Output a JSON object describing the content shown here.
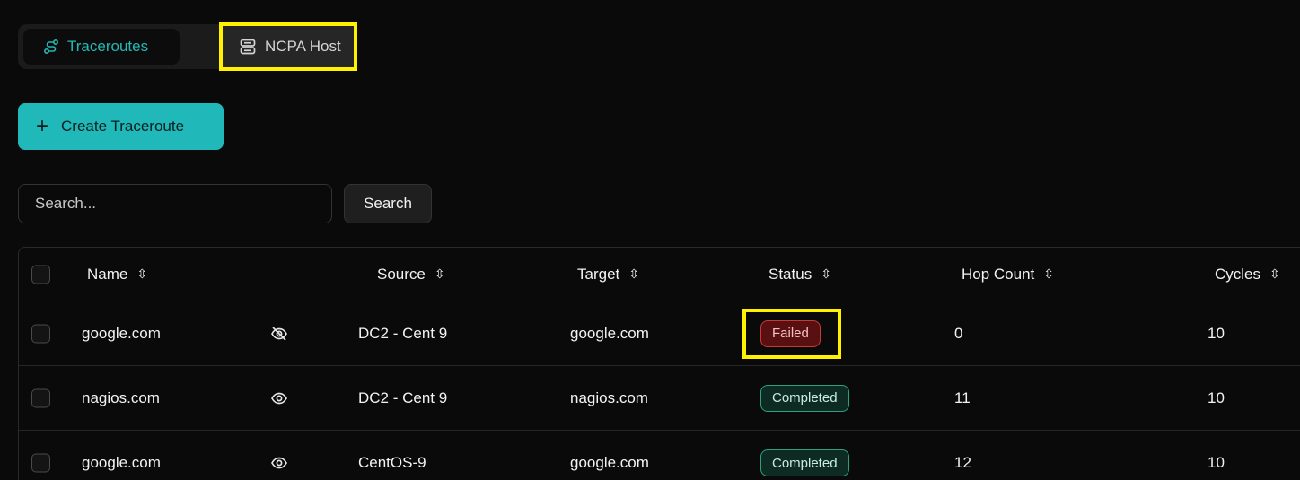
{
  "tabs": [
    {
      "label": "Traceroutes",
      "icon": "route-icon",
      "active": true
    },
    {
      "label": "NCPA Host",
      "icon": "server-icon",
      "active": false
    }
  ],
  "create_button": {
    "label": "Create Traceroute",
    "icon": "plus"
  },
  "search": {
    "placeholder": "Search...",
    "button_label": "Search"
  },
  "table": {
    "columns": [
      "Name",
      "Source",
      "Target",
      "Status",
      "Hop Count",
      "Cycles"
    ],
    "sort_icon": "⇳",
    "rows": [
      {
        "name": "google.com",
        "visibility": "hidden",
        "source": "DC2 - Cent 9",
        "target": "google.com",
        "status": "Failed",
        "hops": "0",
        "cycles": "10"
      },
      {
        "name": "nagios.com",
        "visibility": "visible",
        "source": "DC2 - Cent 9",
        "target": "nagios.com",
        "status": "Completed",
        "hops": "11",
        "cycles": "10"
      },
      {
        "name": "google.com",
        "visibility": "visible",
        "source": "CentOS-9",
        "target": "google.com",
        "status": "Completed",
        "hops": "12",
        "cycles": "10"
      }
    ]
  },
  "colors": {
    "accent": "#20b8b8",
    "highlight": "#fff200",
    "failed": "#c43a3a",
    "completed": "#2ca27c",
    "background": "#0a0a0a"
  }
}
